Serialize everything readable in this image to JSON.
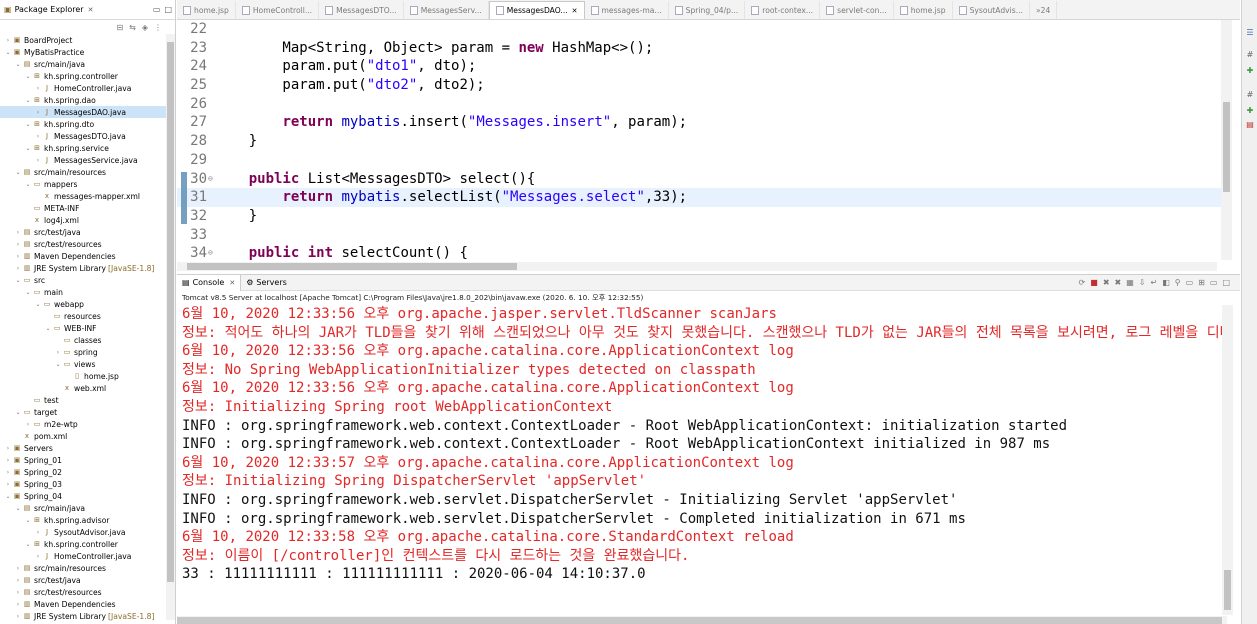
{
  "package_explorer": {
    "title": "Package Explorer",
    "tree": [
      {
        "label": "BoardProject",
        "depth": 0,
        "icon": "project-icon",
        "open": false
      },
      {
        "label": "MyBatisPractice",
        "depth": 0,
        "icon": "project-icon",
        "open": true
      },
      {
        "label": "src/main/java",
        "depth": 1,
        "icon": "source-folder-icon",
        "open": true
      },
      {
        "label": "kh.spring.controller",
        "depth": 2,
        "icon": "package-icon",
        "open": true
      },
      {
        "label": "HomeController.java",
        "depth": 3,
        "icon": "java-file-icon",
        "open": false
      },
      {
        "label": "kh.spring.dao",
        "depth": 2,
        "icon": "package-icon",
        "open": true
      },
      {
        "label": "MessagesDAO.java",
        "depth": 3,
        "icon": "java-file-icon",
        "open": false,
        "selected": true
      },
      {
        "label": "kh.spring.dto",
        "depth": 2,
        "icon": "package-icon",
        "open": true
      },
      {
        "label": "MessagesDTO.java",
        "depth": 3,
        "icon": "java-file-icon",
        "open": false
      },
      {
        "label": "kh.spring.service",
        "depth": 2,
        "icon": "package-icon",
        "open": true
      },
      {
        "label": "MessagesService.java",
        "depth": 3,
        "icon": "java-file-icon",
        "open": false
      },
      {
        "label": "src/main/resources",
        "depth": 1,
        "icon": "source-folder-icon",
        "open": true
      },
      {
        "label": "mappers",
        "depth": 2,
        "icon": "folder-icon",
        "open": true
      },
      {
        "label": "messages-mapper.xml",
        "depth": 3,
        "icon": "xml-file-icon",
        "leaf": true
      },
      {
        "label": "META-INF",
        "depth": 2,
        "icon": "folder-icon",
        "leaf": true
      },
      {
        "label": "log4j.xml",
        "depth": 2,
        "icon": "xml-file-icon",
        "leaf": true
      },
      {
        "label": "src/test/java",
        "depth": 1,
        "icon": "source-folder-icon",
        "open": false
      },
      {
        "label": "src/test/resources",
        "depth": 1,
        "icon": "source-folder-icon",
        "open": false
      },
      {
        "label": "Maven Dependencies",
        "depth": 1,
        "icon": "library-icon",
        "open": false
      },
      {
        "label": "JRE System Library",
        "sub": "[JavaSE-1.8]",
        "depth": 1,
        "icon": "library-icon",
        "open": false
      },
      {
        "label": "src",
        "depth": 1,
        "icon": "folder-icon",
        "open": true
      },
      {
        "label": "main",
        "depth": 2,
        "icon": "folder-icon",
        "open": true
      },
      {
        "label": "webapp",
        "depth": 3,
        "icon": "folder-icon",
        "open": true
      },
      {
        "label": "resources",
        "depth": 4,
        "icon": "folder-icon",
        "leaf": true
      },
      {
        "label": "WEB-INF",
        "depth": 4,
        "icon": "folder-icon",
        "open": true
      },
      {
        "label": "classes",
        "depth": 5,
        "icon": "folder-icon",
        "leaf": true
      },
      {
        "label": "spring",
        "depth": 5,
        "icon": "folder-icon",
        "open": false
      },
      {
        "label": "views",
        "depth": 5,
        "icon": "folder-icon",
        "open": true
      },
      {
        "label": "home.jsp",
        "depth": 6,
        "icon": "jsp-file-icon",
        "leaf": true
      },
      {
        "label": "web.xml",
        "depth": 5,
        "icon": "xml-file-icon",
        "leaf": true
      },
      {
        "label": "test",
        "depth": 2,
        "icon": "folder-icon",
        "leaf": true
      },
      {
        "label": "target",
        "depth": 1,
        "icon": "folder-icon",
        "open": true
      },
      {
        "label": "m2e-wtp",
        "depth": 2,
        "icon": "folder-icon",
        "open": false
      },
      {
        "label": "pom.xml",
        "depth": 1,
        "icon": "xml-file-icon",
        "leaf": true
      },
      {
        "label": "Servers",
        "depth": 0,
        "icon": "project-icon",
        "open": false
      },
      {
        "label": "Spring_01",
        "depth": 0,
        "icon": "project-icon",
        "open": false
      },
      {
        "label": "Spring_02",
        "depth": 0,
        "icon": "project-icon",
        "open": false
      },
      {
        "label": "Spring_03",
        "depth": 0,
        "icon": "project-icon",
        "open": false
      },
      {
        "label": "Spring_04",
        "depth": 0,
        "icon": "project-icon",
        "open": true
      },
      {
        "label": "src/main/java",
        "depth": 1,
        "icon": "source-folder-icon",
        "open": true
      },
      {
        "label": "kh.spring.advisor",
        "depth": 2,
        "icon": "package-icon",
        "open": true
      },
      {
        "label": "SysoutAdvisor.java",
        "depth": 3,
        "icon": "java-file-icon",
        "open": false
      },
      {
        "label": "kh.spring.controller",
        "depth": 2,
        "icon": "package-icon",
        "open": true
      },
      {
        "label": "HomeController.java",
        "depth": 3,
        "icon": "java-file-icon",
        "open": false
      },
      {
        "label": "src/main/resources",
        "depth": 1,
        "icon": "source-folder-icon",
        "open": false
      },
      {
        "label": "src/test/java",
        "depth": 1,
        "icon": "source-folder-icon",
        "open": false
      },
      {
        "label": "src/test/resources",
        "depth": 1,
        "icon": "source-folder-icon",
        "open": false
      },
      {
        "label": "Maven Dependencies",
        "depth": 1,
        "icon": "library-icon",
        "open": false
      },
      {
        "label": "JRE System Library",
        "sub": "[JavaSE-1.8]",
        "depth": 1,
        "icon": "library-icon",
        "open": false
      }
    ]
  },
  "editor": {
    "tabs": [
      {
        "label": "home.jsp",
        "active": false
      },
      {
        "label": "HomeControll...",
        "active": false
      },
      {
        "label": "MessagesDTO...",
        "active": false
      },
      {
        "label": "MessagesServ...",
        "active": false
      },
      {
        "label": "MessagesDAO...",
        "active": true
      },
      {
        "label": "messages-ma...",
        "active": false
      },
      {
        "label": "Spring_04/p...",
        "active": false
      },
      {
        "label": "root-contex...",
        "active": false
      },
      {
        "label": "servlet-con...",
        "active": false
      },
      {
        "label": "home.jsp",
        "active": false
      },
      {
        "label": "SysoutAdvis...",
        "active": false
      }
    ],
    "overflow_count": "»24",
    "lines": [
      {
        "num": "22",
        "tokens": []
      },
      {
        "num": "23",
        "tokens": [
          {
            "t": "        Map<String, Object> param = "
          },
          {
            "t": "new",
            "c": "kw"
          },
          {
            "t": " HashMap<>();"
          }
        ]
      },
      {
        "num": "24",
        "tokens": [
          {
            "t": "        param.put("
          },
          {
            "t": "\"dto1\"",
            "c": "str"
          },
          {
            "t": ", dto);"
          }
        ]
      },
      {
        "num": "25",
        "tokens": [
          {
            "t": "        param.put("
          },
          {
            "t": "\"dto2\"",
            "c": "str"
          },
          {
            "t": ", dto2);"
          }
        ]
      },
      {
        "num": "26",
        "tokens": []
      },
      {
        "num": "27",
        "tokens": [
          {
            "t": "        "
          },
          {
            "t": "return",
            "c": "kw"
          },
          {
            "t": " "
          },
          {
            "t": "mybatis",
            "c": "fld"
          },
          {
            "t": ".insert("
          },
          {
            "t": "\"Messages.insert\"",
            "c": "str"
          },
          {
            "t": ", param);"
          }
        ]
      },
      {
        "num": "28",
        "tokens": [
          {
            "t": "    }"
          }
        ]
      },
      {
        "num": "29",
        "tokens": []
      },
      {
        "num": "30",
        "fold": "⊖",
        "tokens": [
          {
            "t": "    "
          },
          {
            "t": "public",
            "c": "kw"
          },
          {
            "t": " List<MessagesDTO> select(){"
          }
        ]
      },
      {
        "num": "31",
        "current": true,
        "tokens": [
          {
            "t": "        "
          },
          {
            "t": "return",
            "c": "kw"
          },
          {
            "t": " "
          },
          {
            "t": "mybatis",
            "c": "fld"
          },
          {
            "t": ".selectList("
          },
          {
            "t": "\"Messages.select\"",
            "c": "str"
          },
          {
            "t": ",33);"
          }
        ]
      },
      {
        "num": "32",
        "tokens": [
          {
            "t": "    }"
          }
        ]
      },
      {
        "num": "33",
        "tokens": []
      },
      {
        "num": "34",
        "fold": "⊖",
        "tokens": [
          {
            "t": "    "
          },
          {
            "t": "public",
            "c": "kw"
          },
          {
            "t": " "
          },
          {
            "t": "int",
            "c": "kw"
          },
          {
            "t": " selectCount() {"
          }
        ]
      }
    ]
  },
  "console": {
    "tabs": [
      {
        "label": "Console",
        "active": true,
        "icon": "console-icon"
      },
      {
        "label": "Servers",
        "active": false,
        "icon": "servers-icon"
      }
    ],
    "description": "Tomcat v8.5 Server at localhost [Apache Tomcat] C:\\Program Files\\Java\\jre1.8.0_202\\bin\\javaw.exe (2020. 6. 10. 오후 12:32:55)",
    "lines": [
      {
        "text": "6월 10, 2020 12:33:56 오후 org.apache.jasper.servlet.TldScanner scanJars",
        "k": "err"
      },
      {
        "text": "정보: 적어도 하나의 JAR가 TLD들을 찾기 위해 스캔되었으나 아무 것도 찾지 못했습니다. 스캔했으나 TLD가 없는 JAR들의 전체 목록을 보시려면, 로그 레벨을 디버그 레벨로 설",
        "k": "err"
      },
      {
        "text": "6월 10, 2020 12:33:56 오후 org.apache.catalina.core.ApplicationContext log",
        "k": "err"
      },
      {
        "text": "정보: No Spring WebApplicationInitializer types detected on classpath",
        "k": "err"
      },
      {
        "text": "6월 10, 2020 12:33:56 오후 org.apache.catalina.core.ApplicationContext log",
        "k": "err"
      },
      {
        "text": "정보: Initializing Spring root WebApplicationContext",
        "k": "err"
      },
      {
        "text": "INFO : org.springframework.web.context.ContextLoader - Root WebApplicationContext: initialization started",
        "k": "inf"
      },
      {
        "text": "INFO : org.springframework.web.context.ContextLoader - Root WebApplicationContext initialized in 987 ms",
        "k": "inf"
      },
      {
        "text": "6월 10, 2020 12:33:57 오후 org.apache.catalina.core.ApplicationContext log",
        "k": "err"
      },
      {
        "text": "정보: Initializing Spring DispatcherServlet 'appServlet'",
        "k": "err"
      },
      {
        "text": "INFO : org.springframework.web.servlet.DispatcherServlet - Initializing Servlet 'appServlet'",
        "k": "inf"
      },
      {
        "text": "INFO : org.springframework.web.servlet.DispatcherServlet - Completed initialization in 671 ms",
        "k": "inf"
      },
      {
        "text": "6월 10, 2020 12:33:58 오후 org.apache.catalina.core.StandardContext reload",
        "k": "err"
      },
      {
        "text": "정보: 이름이 [/controller]인 컨텍스트를 다시 로드하는 것을 완료했습니다.",
        "k": "err"
      },
      {
        "text": "33 : 11111111111 : 111111111111 : 2020-06-04 14:10:37.0",
        "k": "inf"
      }
    ]
  },
  "colors": {
    "keyword": "#7f0055",
    "string": "#2a00ff",
    "field": "#0000c0",
    "console_error": "#e32828",
    "selection": "#cde3f7"
  }
}
